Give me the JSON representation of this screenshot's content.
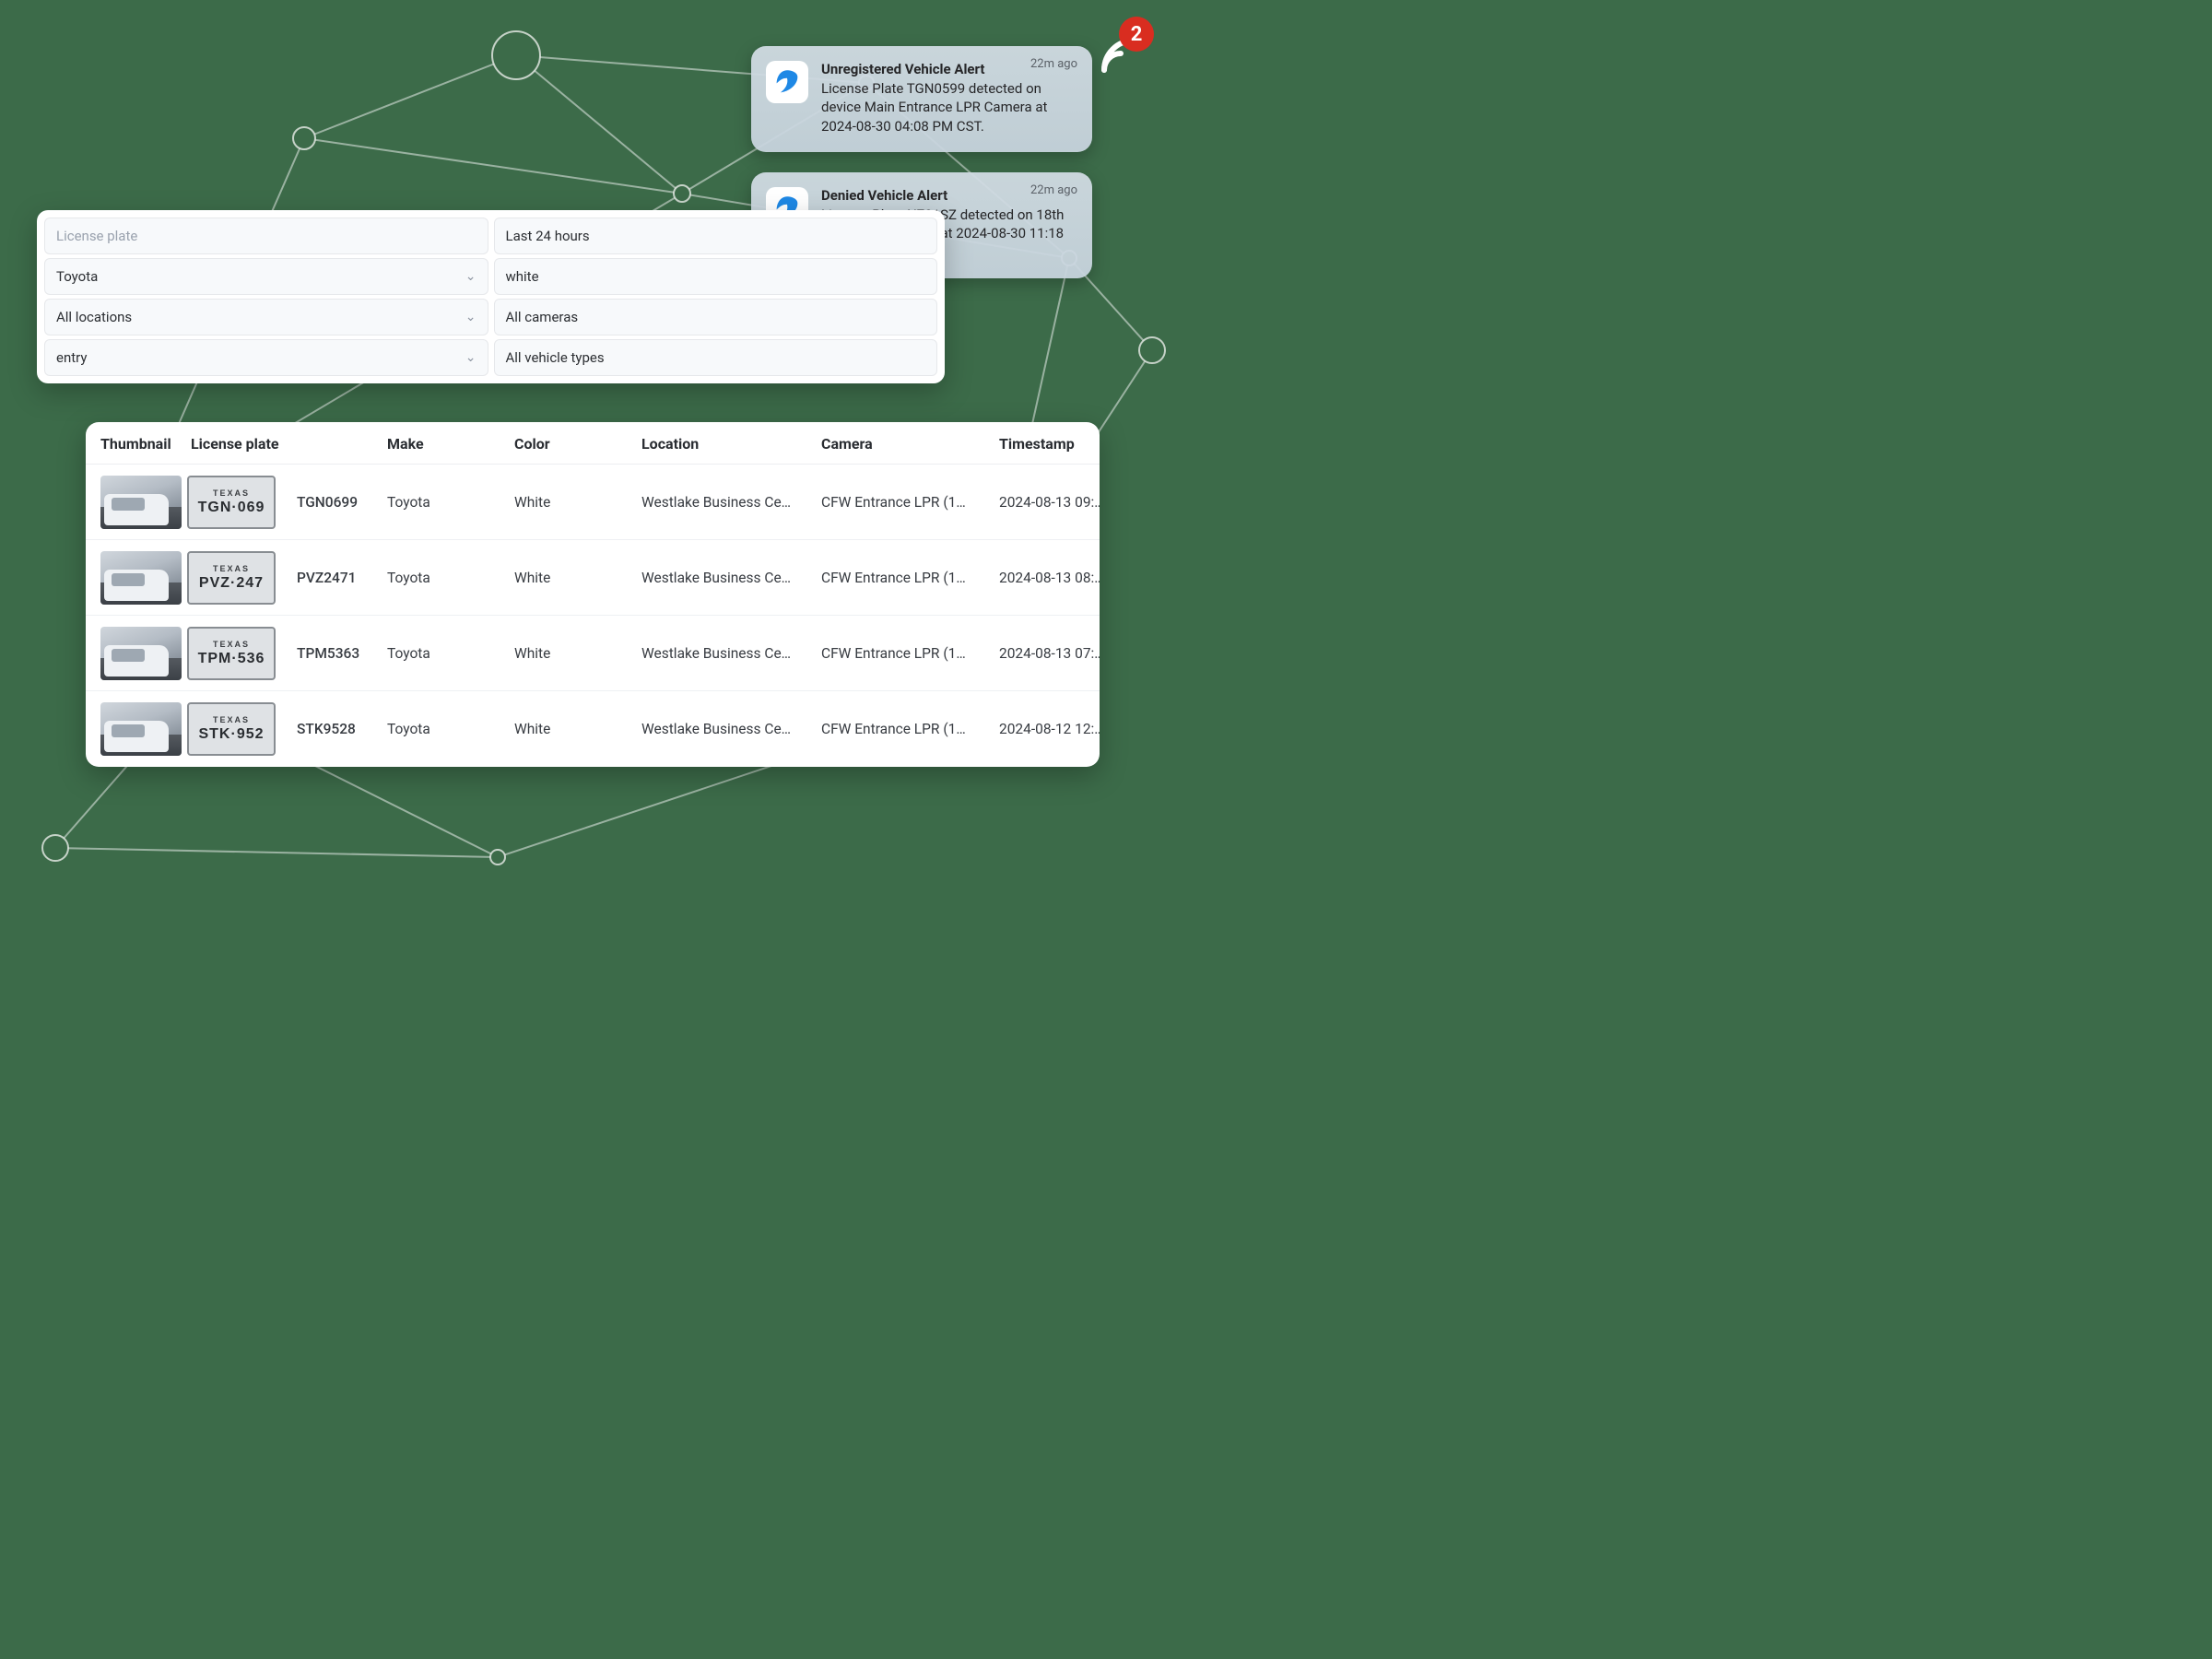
{
  "badge_count": "2",
  "notifications": [
    {
      "title": "Unregistered Vehicle Alert",
      "body": "License Plate TGN0599 detected on device Main Entrance LPR Camera at 2024-08-30 04:08 PM CST.",
      "time": "22m ago"
    },
    {
      "title": "Denied Vehicle Alert",
      "body": "License Plate N781SZ detected on 18th Street LPR Camera at 2024-08-30 11:18 PM CST.",
      "time": "22m ago"
    }
  ],
  "filters": {
    "license_plate_placeholder": "License plate",
    "time_range": "Last 24 hours",
    "make": "Toyota",
    "color": "white",
    "locations": "All locations",
    "cameras": "All cameras",
    "direction": "entry",
    "vehicle_types": "All vehicle types"
  },
  "table": {
    "columns": {
      "thumbnail": "Thumbnail",
      "license_plate": "License plate",
      "make": "Make",
      "color": "Color",
      "location": "Location",
      "camera": "Camera",
      "timestamp": "Timestamp"
    },
    "rows": [
      {
        "plate_state": "TEXAS",
        "plate_display": "TGN·069",
        "license_plate": "TGN0699",
        "make": "Toyota",
        "color": "White",
        "location": "Westlake Business Ce…",
        "camera": "CFW Entrance LPR (1…",
        "timestamp": "2024-08-13 09:…"
      },
      {
        "plate_state": "TEXAS",
        "plate_display": "PVZ·247",
        "license_plate": "PVZ2471",
        "make": "Toyota",
        "color": "White",
        "location": "Westlake Business Ce…",
        "camera": "CFW Entrance LPR (1…",
        "timestamp": "2024-08-13 08:…"
      },
      {
        "plate_state": "TEXAS",
        "plate_display": "TPM·536",
        "license_plate": "TPM5363",
        "make": "Toyota",
        "color": "White",
        "location": "Westlake Business Ce…",
        "camera": "CFW Entrance LPR (1…",
        "timestamp": "2024-08-13 07:…"
      },
      {
        "plate_state": "TEXAS",
        "plate_display": "STK·952",
        "license_plate": "STK9528",
        "make": "Toyota",
        "color": "White",
        "location": "Westlake Business Ce…",
        "camera": "CFW Entrance LPR (1…",
        "timestamp": "2024-08-12 12:…"
      }
    ]
  }
}
